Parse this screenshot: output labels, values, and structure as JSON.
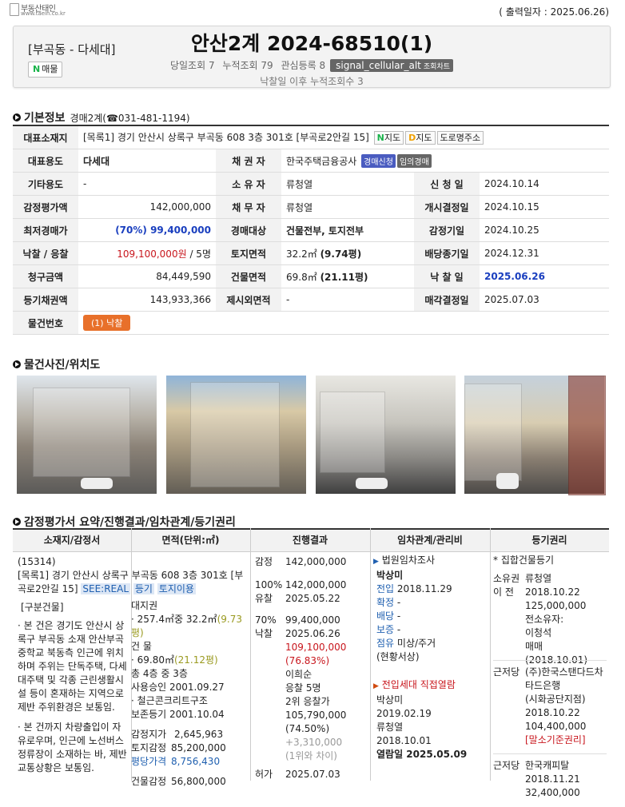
{
  "logo": {
    "name": "부동산태인",
    "url": "www.taein.co.kr"
  },
  "print_date": "( 출력일자 : 2025.06.26)",
  "header": {
    "category": "[부곡동 - 다세대]",
    "badge_n": "N",
    "badge_label": "매물",
    "title": "안산2계 2024-68510(1)",
    "stat1": "당일조회 7",
    "stat2": "누적조회 79",
    "stat3": "관심등록 8",
    "chart_btn": "signal_cellular_alt",
    "chart_btn_small": "조회차트",
    "stat_after": "낙찰일 이후 누적조회수 3"
  },
  "basic": {
    "section_title": "기본정보",
    "court": "경매2계(☎031-481-1194)",
    "labels": {
      "address": "대표소재지",
      "usage": "대표용도",
      "other_usage": "기타용도",
      "appraisal": "감정평가액",
      "min_price": "최저경매가",
      "win_bid": "낙찰 / 응찰",
      "claim": "청구금액",
      "registry_claim": "등기채권액",
      "item_no": "물건번호",
      "creditor": "채 권 자",
      "owner": "소 유 자",
      "debtor": "채 무 자",
      "target": "경매대상",
      "land_area": "토지면적",
      "bldg_area": "건물면적",
      "excluded_area": "제시외면적",
      "apply_date": "신 청 일",
      "start_date": "개시결정일",
      "appraisal_date": "감정기일",
      "dividend_date": "배당종기일",
      "win_date": "낙 찰 일",
      "sale_decision": "매각결정일"
    },
    "address": "[목록1] 경기 안산시 상록구 부곡동 608 3층 301호 [부곡로2안길 15]",
    "map_n": "N",
    "map_n_label": "지도",
    "map_d": "D",
    "map_d_label": "지도",
    "road_addr": "도로명주소",
    "usage": "다세대",
    "other_usage": "-",
    "appraisal": "142,000,000",
    "min_price_pct": "(70%)",
    "min_price": "99,400,000",
    "win_bid": "109,100,000원",
    "bidders": "/ 5명",
    "claim": "84,449,590",
    "registry_claim": "143,933,366",
    "item_no": "(1) 낙찰",
    "creditor": "한국주택금융공사",
    "creditor_tag1": "경매신청",
    "creditor_tag2": "임의경매",
    "owner": "류청열",
    "debtor": "류청열",
    "target": "건물전부, 토지전부",
    "land_area_m2": "32.2㎡",
    "land_area_py": "(9.74평)",
    "bldg_area_m2": "69.8㎡",
    "bldg_area_py": "(21.11평)",
    "excluded_area": "-",
    "apply_date": "2024.10.14",
    "start_date": "2024.10.15",
    "appraisal_date": "2024.10.25",
    "dividend_date": "2024.12.31",
    "win_date": "2025.06.26",
    "sale_decision": "2025.07.03"
  },
  "photos": {
    "section_title": "물건사진/위치도"
  },
  "summary": {
    "section_title": "감정평가서 요약/진행결과/임차관계/등기권리",
    "headers": [
      "소재지/감정서",
      "면적(단위:㎡)",
      "진행결과",
      "임차관계/관리비",
      "등기권리"
    ],
    "zip": "(15314)",
    "addr": "[목록1] 경기 안산시 상록구 부곡동 608 3층 301호 [부곡로2안길 15]",
    "tag_seereal": "SEE:REAL",
    "tag_reg": "등기",
    "tag_land": "토지이용",
    "bldg_section": "[구분건물]",
    "desc1": "· 본 건은 경기도 안산시 상록구 부곡동 소재 안산부곡중학교 북동측 인근에 위치하며 주위는 단독주택, 다세대주택 및 각종 근린생활시설 등이 혼재하는 지역으로 제반 주위환경은 보통임.",
    "desc2": "· 본 건까지 차량출입이 자유로우며, 인근에 노선버스정류장이 소재하는 바, 제반 교통상황은 보통임.",
    "area": {
      "land_right": "대지권",
      "land_line": "· 257.4㎡중 32.2㎡",
      "land_py": "(9.73평)",
      "bldg": "건 물",
      "bldg_line": "· 69.80㎡",
      "bldg_py": "(21.12평)",
      "floors": "총 4층 중 3층",
      "approval": "사용승인 2001.09.27",
      "structure": "· 철근콘크리트구조",
      "registration": "보존등기 2001.10.04",
      "appr_total_label": "감정지가",
      "appr_total": "2,645,963",
      "land_appr_label": "토지감정",
      "land_appr": "85,200,000",
      "py_price_label": "평당가격",
      "py_price": "8,756,430",
      "bldg_appr_label": "건물감정",
      "bldg_appr": "56,800,000"
    },
    "progress": {
      "r1_a": "감정",
      "r1_b": "142,000,000",
      "r2_a": "100%",
      "r2_b": "142,000,000",
      "r3_a": "유찰",
      "r3_b": "2025.05.22",
      "r4_a": "70%",
      "r4_b": "99,400,000",
      "r5_a": "낙찰",
      "r5_b": "2025.06.26",
      "win_amt": "109,100,000",
      "win_pct": "(76.83%)",
      "winner": "이희순",
      "bidders": "응찰 5명",
      "second": "2위 응찰가",
      "second_amt": "105,790,000",
      "second_pct": "(74.50%)",
      "diff_amt": "+3,310,000",
      "diff_label": "(1위와 차이)",
      "r6_a": "허가",
      "r6_b": "2025.07.03"
    },
    "tenant": {
      "survey": "법원임차조사",
      "name": "박상미",
      "movein_label": "전입",
      "movein": "2018.11.29",
      "fixed_label": "확정",
      "fixed": "-",
      "dividend_label": "배당",
      "dividend": "-",
      "deposit_label": "보증",
      "deposit": "-",
      "occupy_label": "점유",
      "occupy": "미상/주거",
      "status": "(현황서상)",
      "direct_title": "전입세대 직접열람",
      "d_name1": "박상미",
      "d_date1": "2019.02.19",
      "d_name2": "류청열",
      "d_date2": "2018.10.01",
      "viewed": "열람일 2025.05.09"
    },
    "registry": {
      "group": "* 집합건물등기",
      "own_label1": "소유권",
      "own_label2": "이 전",
      "own_name": "류청열",
      "own_date": "2018.10.22",
      "own_amt": "125,000,000",
      "prev_owner_label": "전소유자:",
      "prev_owner": "이청석",
      "sale": "매매(2018.10.01)",
      "mort_label": "근저당",
      "mort_name": "(주)한국스탠다드차타드은행",
      "mort_branch": "(시화공단지점)",
      "mort_date": "2018.10.22",
      "mort_amt": "104,400,000",
      "mort_note": "[말소기준권리]",
      "mort2_label": "근저당",
      "mort2_name": "한국캐피탈",
      "mort2_date": "2018.11.21",
      "mort2_amt": "32,400,000"
    }
  }
}
